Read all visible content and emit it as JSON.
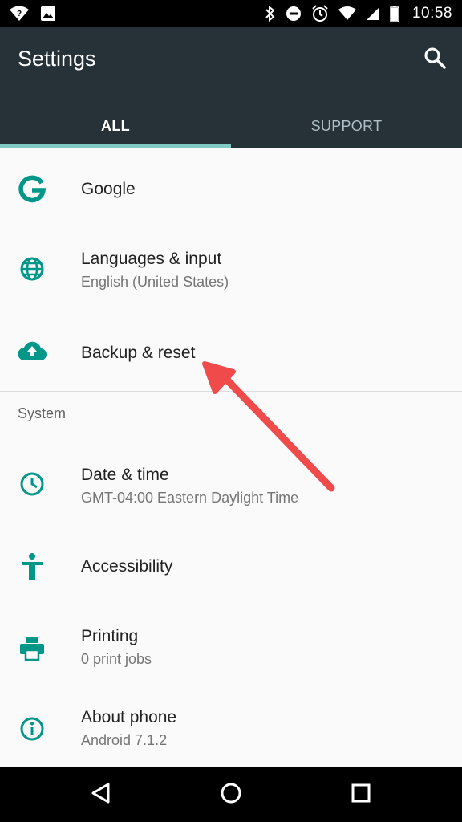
{
  "status_bar": {
    "time": "10:58"
  },
  "app_bar": {
    "title": "Settings"
  },
  "tabs": [
    {
      "label": "ALL",
      "active": true
    },
    {
      "label": "SUPPORT",
      "active": false
    }
  ],
  "items": [
    {
      "icon": "google-icon",
      "title": "Google",
      "subtitle": ""
    },
    {
      "icon": "globe-icon",
      "title": "Languages & input",
      "subtitle": "English (United States)"
    },
    {
      "icon": "cloud-upload-icon",
      "title": "Backup & reset",
      "subtitle": ""
    }
  ],
  "section": {
    "header": "System"
  },
  "system_items": [
    {
      "icon": "clock-icon",
      "title": "Date & time",
      "subtitle": "GMT-04:00 Eastern Daylight Time"
    },
    {
      "icon": "accessibility-icon",
      "title": "Accessibility",
      "subtitle": ""
    },
    {
      "icon": "printer-icon",
      "title": "Printing",
      "subtitle": "0 print jobs"
    },
    {
      "icon": "info-icon",
      "title": "About phone",
      "subtitle": "Android 7.1.2"
    }
  ],
  "colors": {
    "accent": "#009688",
    "app_bar": "#263238",
    "indicator": "#80cbc4",
    "annotation_arrow": "#f04a4a"
  }
}
